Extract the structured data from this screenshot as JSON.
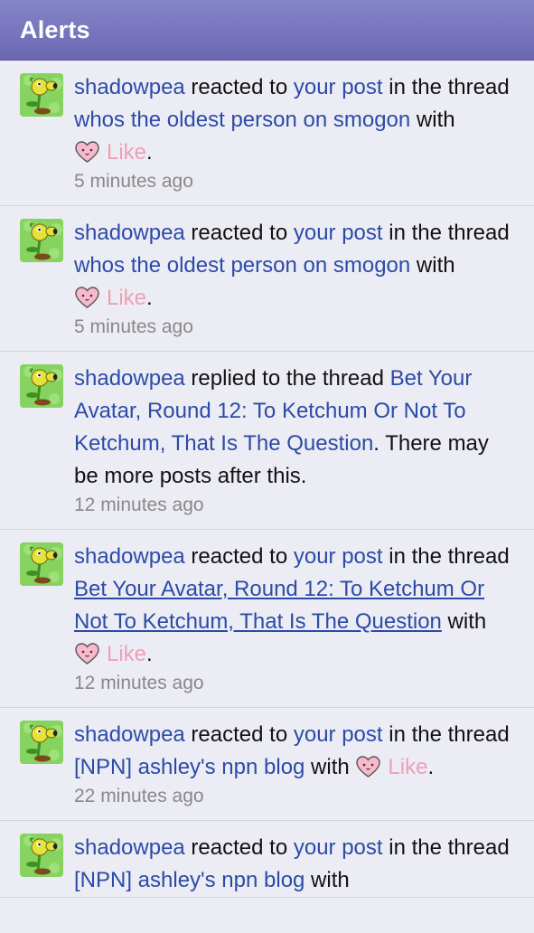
{
  "header": {
    "title": "Alerts"
  },
  "alerts": [
    {
      "user": "shadowpea",
      "pre": " reacted to ",
      "link1": "your post",
      "mid": " in the thread ",
      "thread": "whos the oldest person on smogon",
      "post": " with ",
      "reaction": "Like",
      "end": ".",
      "time": "5 minutes ago"
    },
    {
      "user": "shadowpea",
      "pre": " reacted to ",
      "link1": "your post",
      "mid": " in the thread ",
      "thread": "whos the oldest person on smogon",
      "post": " with ",
      "reaction": "Like",
      "end": ".",
      "time": "5 minutes ago"
    },
    {
      "user": "shadowpea",
      "pre": " replied to the thread ",
      "thread": "Bet Your Avatar, Round 12: To Ketchum Or Not To Ketchum, That Is The Question",
      "post": ". There may be more posts after this.",
      "time": "12 minutes ago"
    },
    {
      "user": "shadowpea",
      "pre": " reacted to ",
      "link1": "your post",
      "mid": " in the thread ",
      "thread": "Bet Your Avatar, Round 12: To Ketchum Or Not To Ketchum, That Is The Question",
      "post": " with ",
      "reaction": "Like",
      "end": ".",
      "time": "12 minutes ago"
    },
    {
      "user": "shadowpea",
      "pre": " reacted to ",
      "link1": "your post",
      "mid": " in the thread ",
      "thread": "[NPN] ashley's npn blog",
      "post": " with ",
      "reaction": "Like",
      "end": ".",
      "time": "22 minutes ago"
    },
    {
      "user": "shadowpea",
      "pre": " reacted to ",
      "link1": "your post",
      "mid": " in the thread ",
      "thread": "[NPN] ashley's npn blog",
      "post": " with"
    }
  ],
  "colors": {
    "header": "#7673bd",
    "link": "#2c4aa8",
    "reaction": "#ef9fb6",
    "timestamp": "#888888",
    "background": "#ecedf4"
  },
  "icons": {
    "avatar": "peashooter-avatar-icon",
    "reaction": "heart-like-icon"
  }
}
